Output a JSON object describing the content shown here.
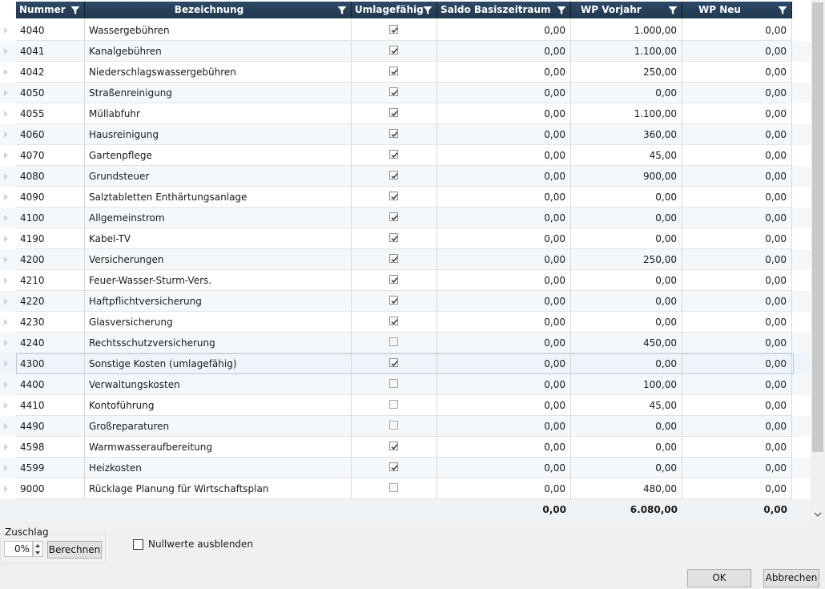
{
  "columns": [
    {
      "key": "nummer",
      "label": "Nummer"
    },
    {
      "key": "bezeichnung",
      "label": "Bezeichnung"
    },
    {
      "key": "umlagefaehig",
      "label": "Umlagefähig"
    },
    {
      "key": "saldo",
      "label": "Saldo Basiszeitraum"
    },
    {
      "key": "wp_vorjahr",
      "label": "WP Vorjahr"
    },
    {
      "key": "wp_neu",
      "label": "WP Neu"
    }
  ],
  "rows": [
    {
      "nummer": "4040",
      "bezeichnung": "Wassergebühren",
      "umlagefaehig": true,
      "saldo": "0,00",
      "wp_vorjahr": "1.000,00",
      "wp_neu": "0,00"
    },
    {
      "nummer": "4041",
      "bezeichnung": "Kanalgebühren",
      "umlagefaehig": true,
      "saldo": "0,00",
      "wp_vorjahr": "1.100,00",
      "wp_neu": "0,00"
    },
    {
      "nummer": "4042",
      "bezeichnung": "Niederschlagswassergebühren",
      "umlagefaehig": true,
      "saldo": "0,00",
      "wp_vorjahr": "250,00",
      "wp_neu": "0,00"
    },
    {
      "nummer": "4050",
      "bezeichnung": "Straßenreinigung",
      "umlagefaehig": true,
      "saldo": "0,00",
      "wp_vorjahr": "0,00",
      "wp_neu": "0,00"
    },
    {
      "nummer": "4055",
      "bezeichnung": "Müllabfuhr",
      "umlagefaehig": true,
      "saldo": "0,00",
      "wp_vorjahr": "1.100,00",
      "wp_neu": "0,00"
    },
    {
      "nummer": "4060",
      "bezeichnung": "Hausreinigung",
      "umlagefaehig": true,
      "saldo": "0,00",
      "wp_vorjahr": "360,00",
      "wp_neu": "0,00"
    },
    {
      "nummer": "4070",
      "bezeichnung": "Gartenpflege",
      "umlagefaehig": true,
      "saldo": "0,00",
      "wp_vorjahr": "45,00",
      "wp_neu": "0,00"
    },
    {
      "nummer": "4080",
      "bezeichnung": "Grundsteuer",
      "umlagefaehig": true,
      "saldo": "0,00",
      "wp_vorjahr": "900,00",
      "wp_neu": "0,00"
    },
    {
      "nummer": "4090",
      "bezeichnung": "Salztabletten Enthärtungsanlage",
      "umlagefaehig": true,
      "saldo": "0,00",
      "wp_vorjahr": "0,00",
      "wp_neu": "0,00"
    },
    {
      "nummer": "4100",
      "bezeichnung": "Allgemeinstrom",
      "umlagefaehig": true,
      "saldo": "0,00",
      "wp_vorjahr": "0,00",
      "wp_neu": "0,00"
    },
    {
      "nummer": "4190",
      "bezeichnung": "Kabel-TV",
      "umlagefaehig": true,
      "saldo": "0,00",
      "wp_vorjahr": "0,00",
      "wp_neu": "0,00"
    },
    {
      "nummer": "4200",
      "bezeichnung": "Versicherungen",
      "umlagefaehig": true,
      "saldo": "0,00",
      "wp_vorjahr": "250,00",
      "wp_neu": "0,00"
    },
    {
      "nummer": "4210",
      "bezeichnung": "Feuer-Wasser-Sturm-Vers.",
      "umlagefaehig": true,
      "saldo": "0,00",
      "wp_vorjahr": "0,00",
      "wp_neu": "0,00"
    },
    {
      "nummer": "4220",
      "bezeichnung": "Haftpflichtversicherung",
      "umlagefaehig": true,
      "saldo": "0,00",
      "wp_vorjahr": "0,00",
      "wp_neu": "0,00"
    },
    {
      "nummer": "4230",
      "bezeichnung": "Glasversicherung",
      "umlagefaehig": true,
      "saldo": "0,00",
      "wp_vorjahr": "0,00",
      "wp_neu": "0,00"
    },
    {
      "nummer": "4240",
      "bezeichnung": "Rechtsschutzversicherung",
      "umlagefaehig": false,
      "saldo": "0,00",
      "wp_vorjahr": "450,00",
      "wp_neu": "0,00"
    },
    {
      "nummer": "4300",
      "bezeichnung": "Sonstige Kosten (umlagefähig)",
      "umlagefaehig": true,
      "saldo": "0,00",
      "wp_vorjahr": "0,00",
      "wp_neu": "0,00",
      "selected": true
    },
    {
      "nummer": "4400",
      "bezeichnung": "Verwaltungskosten",
      "umlagefaehig": false,
      "saldo": "0,00",
      "wp_vorjahr": "100,00",
      "wp_neu": "0,00"
    },
    {
      "nummer": "4410",
      "bezeichnung": "Kontoführung",
      "umlagefaehig": false,
      "saldo": "0,00",
      "wp_vorjahr": "45,00",
      "wp_neu": "0,00"
    },
    {
      "nummer": "4490",
      "bezeichnung": "Großreparaturen",
      "umlagefaehig": false,
      "saldo": "0,00",
      "wp_vorjahr": "0,00",
      "wp_neu": "0,00"
    },
    {
      "nummer": "4598",
      "bezeichnung": "Warmwasseraufbereitung",
      "umlagefaehig": true,
      "saldo": "0,00",
      "wp_vorjahr": "0,00",
      "wp_neu": "0,00"
    },
    {
      "nummer": "4599",
      "bezeichnung": "Heizkosten",
      "umlagefaehig": true,
      "saldo": "0,00",
      "wp_vorjahr": "0,00",
      "wp_neu": "0,00"
    },
    {
      "nummer": "9000",
      "bezeichnung": "Rücklage Planung für Wirtschaftsplan",
      "umlagefaehig": false,
      "saldo": "0,00",
      "wp_vorjahr": "480,00",
      "wp_neu": "0,00"
    }
  ],
  "totals": {
    "saldo": "0,00",
    "wp_vorjahr": "6.080,00",
    "wp_neu": "0,00"
  },
  "footer": {
    "zuschlag_label": "Zuschlag",
    "zuschlag_value": "0%",
    "berechnen_label": "Berechnen",
    "nullwerte_label": "Nullwerte ausblenden",
    "nullwerte_checked": false,
    "ok_label": "OK",
    "abbrechen_label": "Abbrechen"
  },
  "colors": {
    "header_bg": "#2d4a67",
    "alt_row": "#f4f8fb",
    "selected_border": "#b5cde4"
  }
}
